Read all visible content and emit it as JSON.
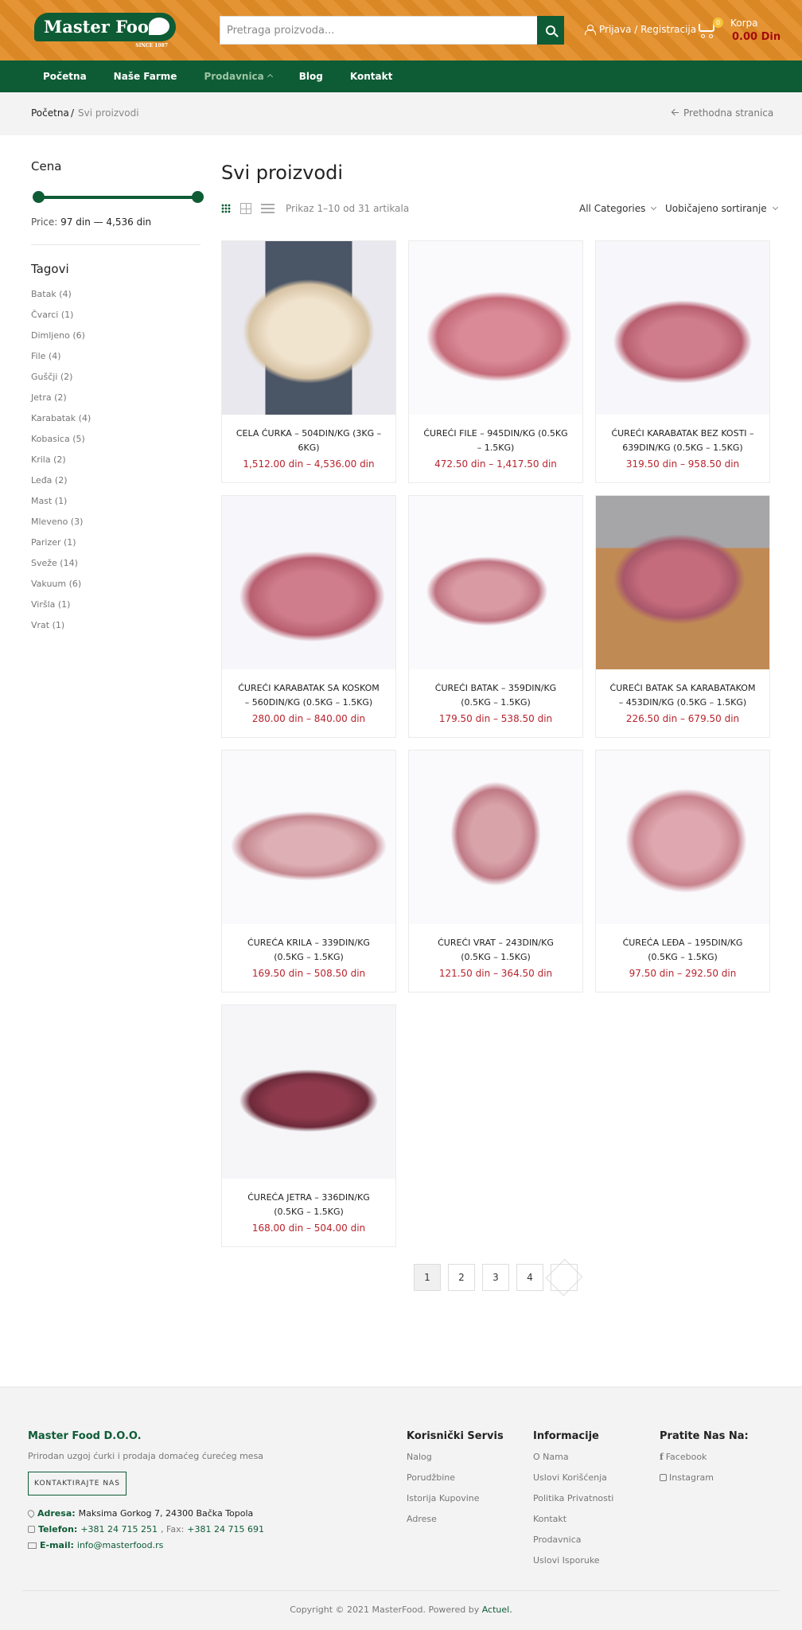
{
  "header": {
    "logo_text": "Master Food",
    "logo_since": "SINCE 1987",
    "search_placeholder": "Pretraga proizvoda...",
    "login_label": "Prijava / Registracija",
    "cart_count": "0",
    "cart_label": "Korpa",
    "cart_total": "0.00 Din"
  },
  "nav": {
    "items": [
      "Početna",
      "Naše Farme",
      "Prodavnica",
      "Blog",
      "Kontakt"
    ]
  },
  "breadcrumb": {
    "home": "Početna",
    "separator": "/",
    "current": "Svi proizvodi",
    "back": "Prethodna stranica"
  },
  "sidebar": {
    "price_title": "Cena",
    "price_label": "Price:",
    "price_range": "97 din — 4,536 din",
    "tags_title": "Tagovi",
    "tags": [
      "Batak (4)",
      "Čvarci (1)",
      "Dimljeno (6)",
      "File (4)",
      "Guščji (2)",
      "Jetra (2)",
      "Karabatak (4)",
      "Kobasica (5)",
      "Krila (2)",
      "Leđa (2)",
      "Mast (1)",
      "Mleveno (3)",
      "Parizer (1)",
      "Sveže (14)",
      "Vakuum (6)",
      "Viršla (1)",
      "Vrat (1)"
    ]
  },
  "main": {
    "title": "Svi proizvodi",
    "result_count": "Prikaz 1–10 od 31 artikala",
    "category_select": "All Categories",
    "sort_select": "Uobičajeno sortiranje"
  },
  "products": [
    {
      "name": "CELA ĆURKA – 504DIN/KG (3KG – 6KG)",
      "price": "1,512.00 din – 4,536.00 din"
    },
    {
      "name": "ĆUREĆI FILE – 945DIN/KG (0.5KG – 1.5KG)",
      "price": "472.50 din – 1,417.50 din"
    },
    {
      "name": "ĆUREĆI KARABATAK BEZ KOSTI – 639DIN/KG (0.5KG – 1.5KG)",
      "price": "319.50 din – 958.50 din"
    },
    {
      "name": "ĆUREĆI KARABATAK SA KOSKOM – 560DIN/KG (0.5KG – 1.5KG)",
      "price": "280.00 din – 840.00 din"
    },
    {
      "name": "ĆUREĆI BATAK – 359DIN/KG (0.5KG – 1.5KG)",
      "price": "179.50 din – 538.50 din"
    },
    {
      "name": "ĆUREĆI BATAK SA KARABATAKOM – 453DIN/KG (0.5KG – 1.5KG)",
      "price": "226.50 din – 679.50 din"
    },
    {
      "name": "ĆUREĆA KRILA – 339DIN/KG (0.5KG – 1.5KG)",
      "price": "169.50 din – 508.50 din"
    },
    {
      "name": "ĆUREĆI VRAT – 243DIN/KG (0.5KG – 1.5KG)",
      "price": "121.50 din – 364.50 din"
    },
    {
      "name": "ĆUREĆA LEĐA – 195DIN/KG (0.5KG – 1.5KG)",
      "price": "97.50 din – 292.50 din"
    },
    {
      "name": "ĆUREĆA JETRA – 336DIN/KG (0.5KG – 1.5KG)",
      "price": "168.00 din – 504.00 din"
    }
  ],
  "pagination": {
    "pages": [
      "1",
      "2",
      "3",
      "4"
    ],
    "current": "1"
  },
  "footer": {
    "company": "Master Food D.O.O.",
    "tagline": "Prirodan uzgoj ćurki i prodaja domaćeg ćurećeg mesa",
    "contact_button": "KONTAKTIRAJTE NAS",
    "address_label": "Adresa:",
    "address_value": "Maksima Gorkog 7, 24300 Bačka Topola",
    "phone_label": "Telefon:",
    "phone_value": "+381 24 715 251",
    "fax_label": ", Fax:",
    "fax_value": "+381 24 715 691",
    "email_label": "E-mail:",
    "email_value": "info@masterfood.rs",
    "col1_title": "Korisnički Servis",
    "col1_items": [
      "Nalog",
      "Porudžbine",
      "Istorija Kupovine",
      "Adrese"
    ],
    "col2_title": "Informacije",
    "col2_items": [
      "O Nama",
      "Uslovi Korišćenja",
      "Politika Privatnosti",
      "Kontakt",
      "Prodavnica",
      "Uslovi Isporuke"
    ],
    "col3_title": "Pratite Nas Na:",
    "social": [
      "Facebook",
      "Instagram"
    ],
    "copyright": "Copyright © 2021 MasterFood. Powered by",
    "powered_by": "Actuel."
  },
  "colors": {
    "brand_green": "#0e5c35",
    "brand_orange": "#e38d27",
    "price_red": "#b8242d"
  }
}
